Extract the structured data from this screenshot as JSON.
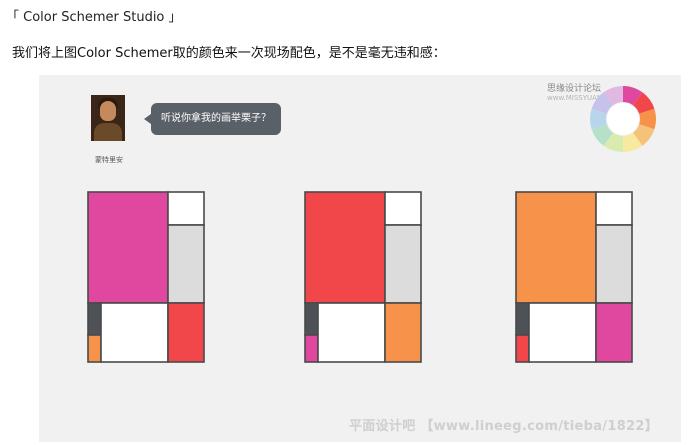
{
  "heading": "「 Color Schemer Studio 」",
  "intro": "我们将上图Color Schemer取的颜色来一次现场配色，是不是毫无违和感：",
  "avatar": {
    "name": "蒙特里安"
  },
  "bubble": {
    "text": "听说你拿我的画举栗子？"
  },
  "watermark_top": {
    "label": "思缘设计论坛",
    "site": "www.MISSYUAN.COM"
  },
  "footer_watermark": "平面设计吧 【www.lineeg.com/tieba/1822】",
  "colors": {
    "magenta": "#e0479e",
    "red": "#f2474a",
    "orange": "#f7924a",
    "dark": "#4e5257",
    "gray": "#dcdcdc",
    "white": "#ffffff",
    "border": "#4a4a4a"
  },
  "compositions": [
    {
      "main": "magenta",
      "bottom_right": "red",
      "small_left": "orange"
    },
    {
      "main": "red",
      "bottom_right": "orange",
      "small_left": "magenta"
    },
    {
      "main": "orange",
      "bottom_right": "magenta",
      "small_left": "red"
    }
  ],
  "color_wheel": {
    "segments": [
      "#e0479e",
      "#f2474a",
      "#f7924a",
      "#f5c27a",
      "#f7e9a0",
      "#d8ecb0",
      "#b6e0c8",
      "#b7d6ec",
      "#c6c2ec",
      "#e0b8e2"
    ]
  }
}
